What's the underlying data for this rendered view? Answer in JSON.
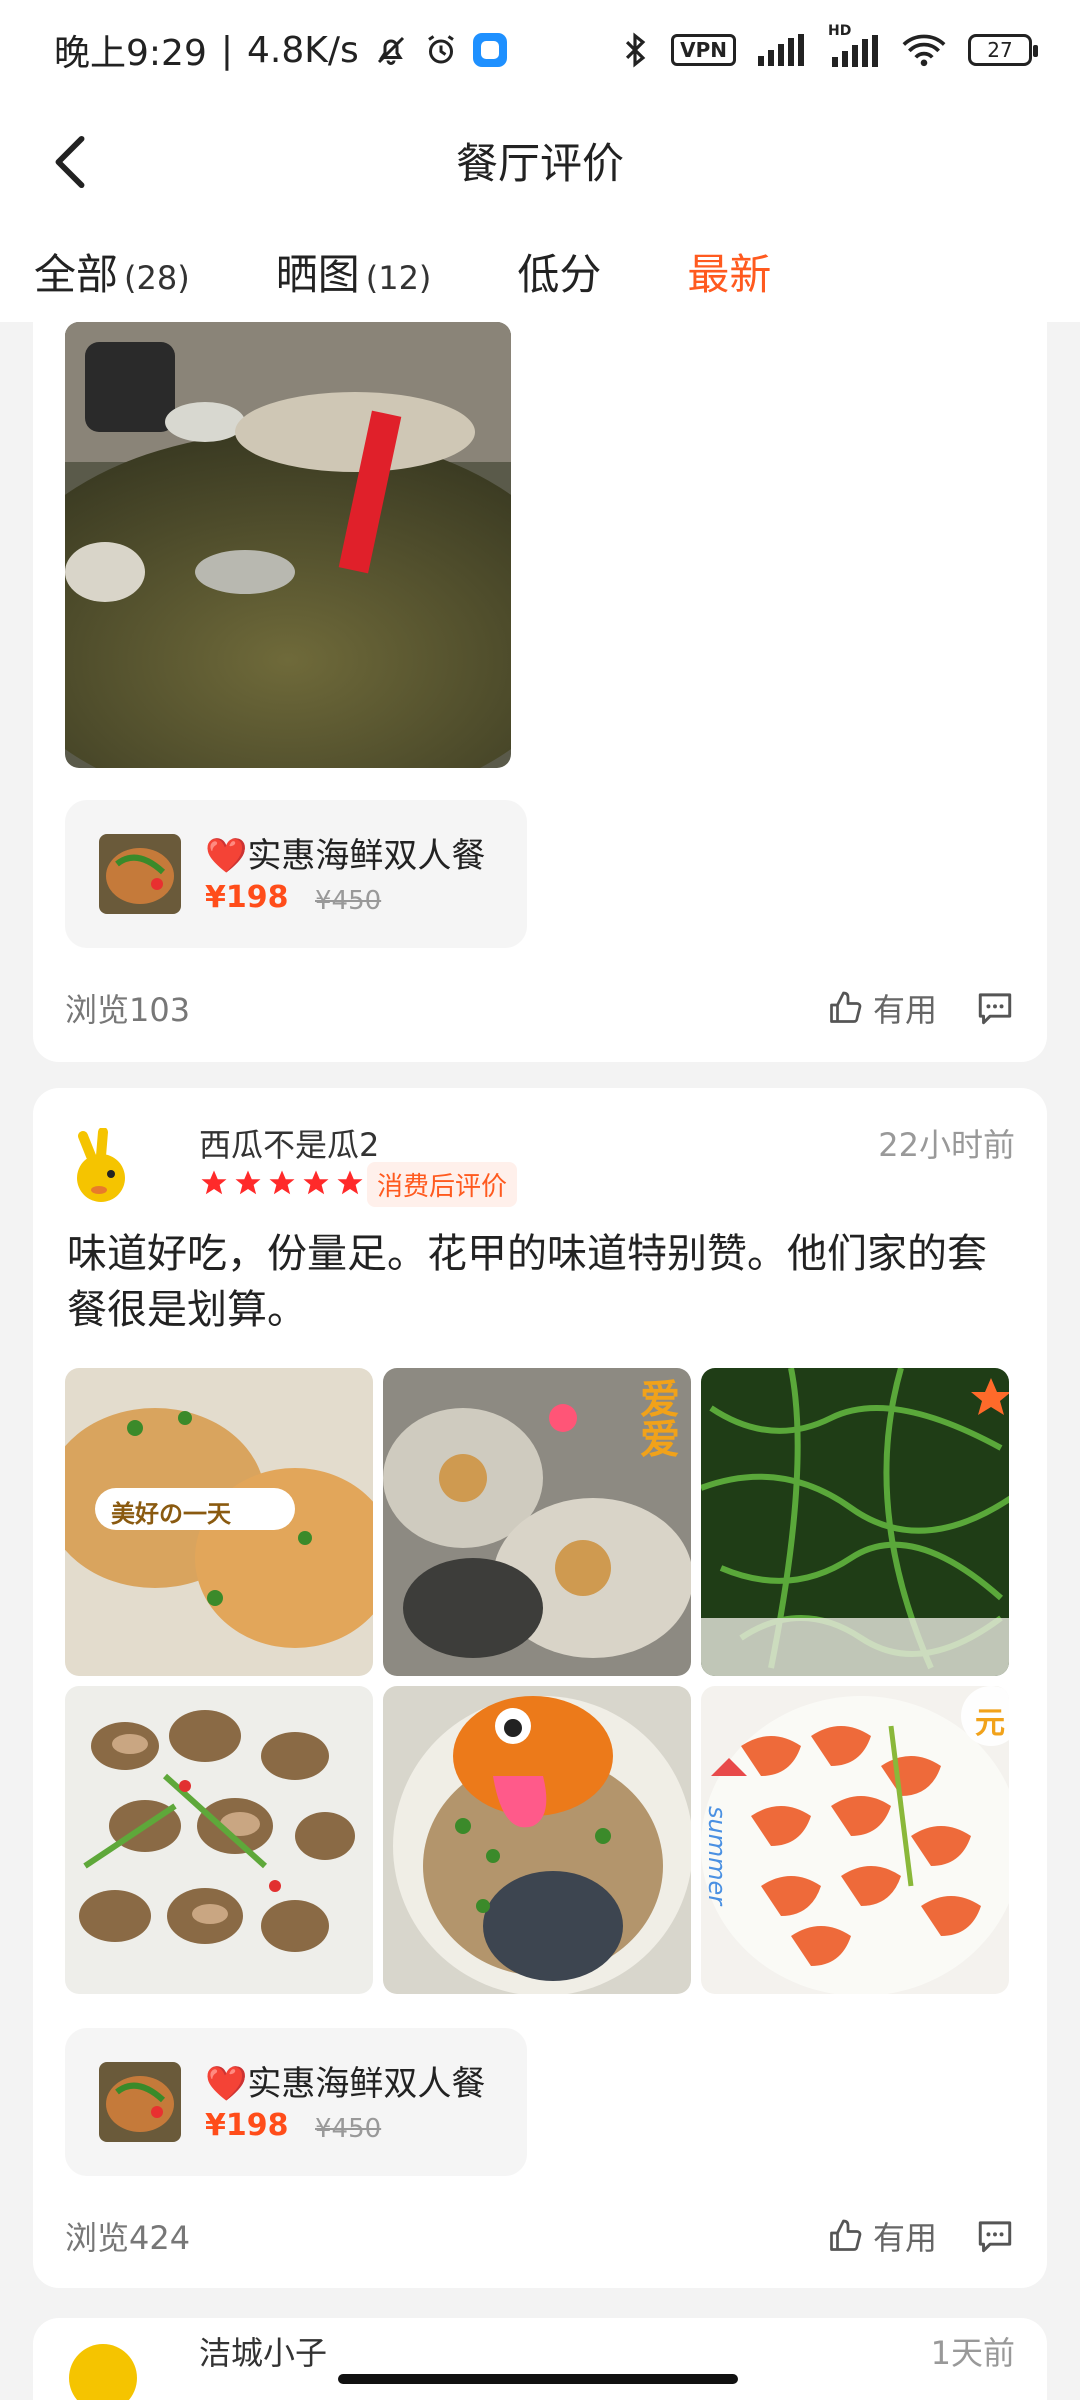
{
  "status_bar": {
    "time": "晚上9:29",
    "speed": "4.8K/s",
    "vpn": "VPN",
    "hd": "HD",
    "battery": "27"
  },
  "header": {
    "title": "餐厅评价"
  },
  "tabs": [
    {
      "label": "全部",
      "count": "(28)"
    },
    {
      "label": "晒图",
      "count": "(12)"
    },
    {
      "label": "低分",
      "count": ""
    },
    {
      "label": "最新",
      "count": ""
    }
  ],
  "card1": {
    "set": {
      "name": "❤️实惠海鲜双人餐",
      "price": "¥198",
      "original": "¥450"
    },
    "views": "浏览103",
    "useful": "有用"
  },
  "card2": {
    "user": "西瓜不是瓜2",
    "time": "22小时前",
    "badge": "消费后评价",
    "text": "味道好吃，份量足。花甲的味道特别赞。他们家的套餐很是划算。",
    "photo_labels": [
      "美好の一天",
      "爱爱",
      "summer",
      "元"
    ],
    "set": {
      "name": "❤️实惠海鲜双人餐",
      "price": "¥198",
      "original": "¥450"
    },
    "views": "浏览424",
    "useful": "有用"
  },
  "card3": {
    "user": "洁城小子",
    "time": "1天前"
  },
  "colors": {
    "accent": "#ff5a1f",
    "star": "#ff2a2a"
  }
}
